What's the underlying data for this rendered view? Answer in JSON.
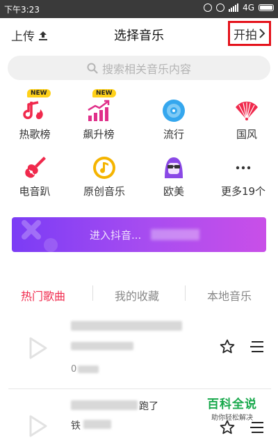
{
  "status_bar": {
    "time": "下午3:23",
    "network": "4G"
  },
  "header": {
    "upload_label": "上传",
    "title": "选择音乐",
    "shoot_label": "开拍"
  },
  "search": {
    "placeholder": "搜索相关音乐内容"
  },
  "categories": [
    {
      "label": "热歌榜",
      "badge": "NEW",
      "icon": "hot-song-icon",
      "color": "#f0294c"
    },
    {
      "label": "飙升榜",
      "badge": "NEW",
      "icon": "rising-chart-icon",
      "color": "#e0308a"
    },
    {
      "label": "流行",
      "icon": "disc-icon",
      "color": "#35a7ee"
    },
    {
      "label": "国风",
      "icon": "folding-fan-icon",
      "color": "#f0294c"
    },
    {
      "label": "电音趴",
      "icon": "electric-guitar-icon",
      "color": "#f0294c"
    },
    {
      "label": "原创音乐",
      "icon": "original-music-icon",
      "color": "#f5b400"
    },
    {
      "label": "欧美",
      "icon": "western-avatar-icon",
      "color": "#8a48e6"
    },
    {
      "label": "更多19个",
      "icon": "more-icon",
      "color": "#333333"
    }
  ],
  "banner": {
    "text": "进入抖音..."
  },
  "tabs": [
    {
      "label": "热门歌曲",
      "active": true
    },
    {
      "label": "我的收藏",
      "active": false
    },
    {
      "label": "本地音乐",
      "active": false
    }
  ],
  "songs": [
    {
      "duration_prefix": "0"
    },
    {
      "title_suffix": "跑了",
      "artist_prefix": "铁"
    }
  ],
  "watermark": {
    "title": "百科全说",
    "subtitle": "助你轻松解决"
  },
  "colors": {
    "accent": "#f0294c",
    "highlight_border": "#e4111a",
    "banner_start": "#7b3cf5",
    "banner_end": "#c94fe8"
  }
}
